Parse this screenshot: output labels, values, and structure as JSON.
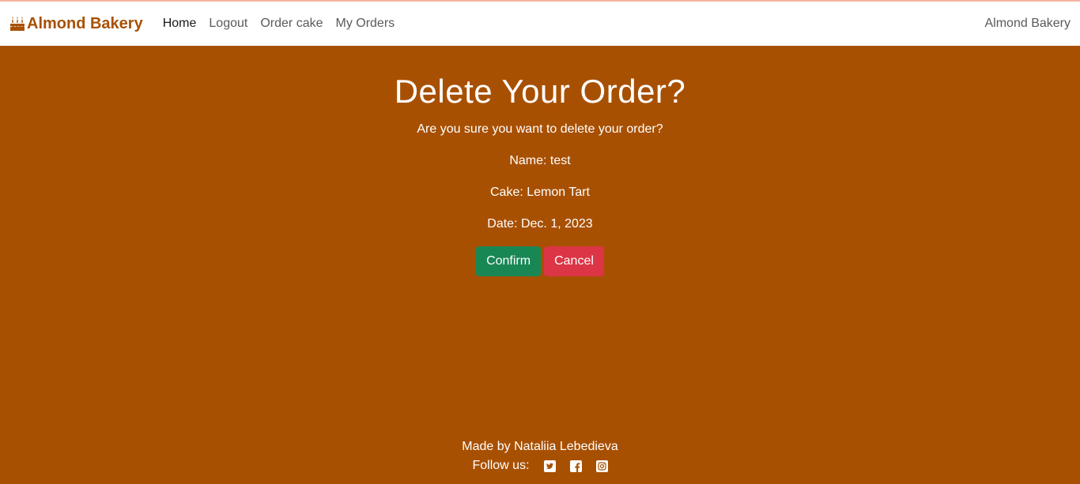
{
  "nav": {
    "brand": "Almond Bakery",
    "links": [
      "Home",
      "Logout",
      "Order cake",
      "My Orders"
    ],
    "right_text": "Almond Bakery"
  },
  "main": {
    "title": "Delete Your Order?",
    "prompt": "Are you sure you want to delete your order?",
    "name_line": "Name: test",
    "cake_line": "Cake: Lemon Tart",
    "date_line": "Date: Dec. 1, 2023",
    "confirm_label": "Confirm",
    "cancel_label": "Cancel"
  },
  "footer": {
    "made_by": "Made by Nataliia Lebedieva",
    "follow_label": "Follow us:",
    "social_icons": [
      "twitter-icon",
      "facebook-icon",
      "instagram-icon"
    ]
  },
  "colors": {
    "brand": "#a85002",
    "background": "#a85002",
    "confirm": "#198754",
    "cancel": "#dc3545"
  }
}
